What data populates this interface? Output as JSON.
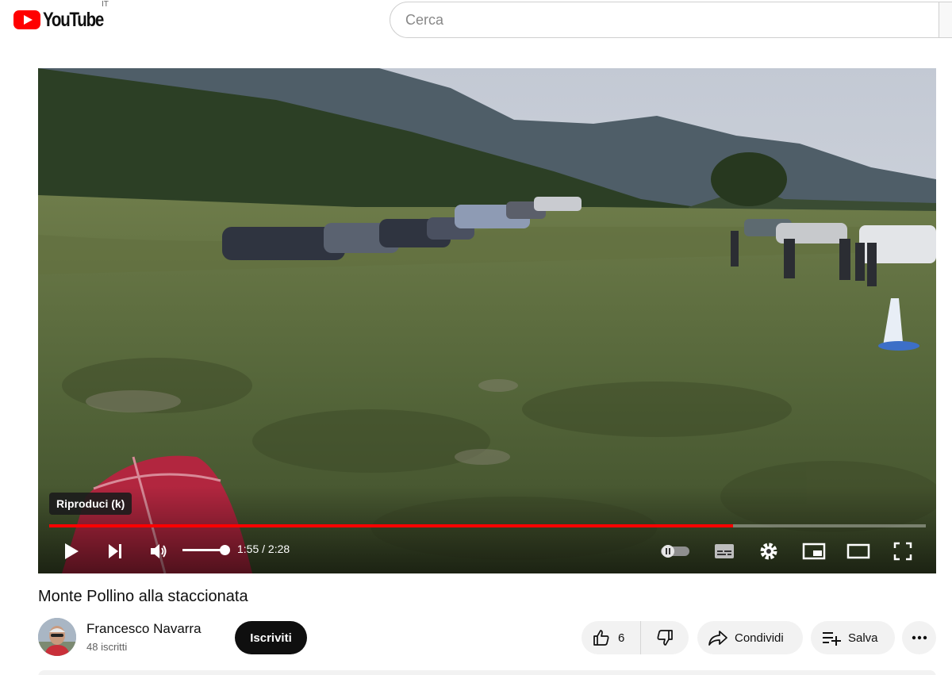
{
  "header": {
    "logo_text": "YouTube",
    "country_code": "IT",
    "search_placeholder": "Cerca"
  },
  "player": {
    "tooltip": "Riproduci (k)",
    "time_current": "1:55",
    "time_separator": " / ",
    "time_total": "2:28",
    "progress_fraction": 0.78,
    "volume_fraction": 1.0,
    "icons": [
      "play-icon",
      "next-icon",
      "volume-icon",
      "autoplay-toggle-icon",
      "subtitles-icon",
      "settings-gear-icon",
      "miniplayer-icon",
      "theater-mode-icon",
      "fullscreen-icon"
    ]
  },
  "video": {
    "title": "Monte Pollino alla staccionata"
  },
  "channel": {
    "name": "Francesco Navarra",
    "subscribers": "48 iscritti",
    "subscribe_label": "Iscriviti"
  },
  "actions": {
    "likes": "6",
    "share_label": "Condividi",
    "save_label": "Salva"
  },
  "colors": {
    "brand_red": "#ff0000",
    "progress_red": "#ff0000",
    "button_dark": "#0f0f0f",
    "pill_bg": "#f2f2f2"
  }
}
